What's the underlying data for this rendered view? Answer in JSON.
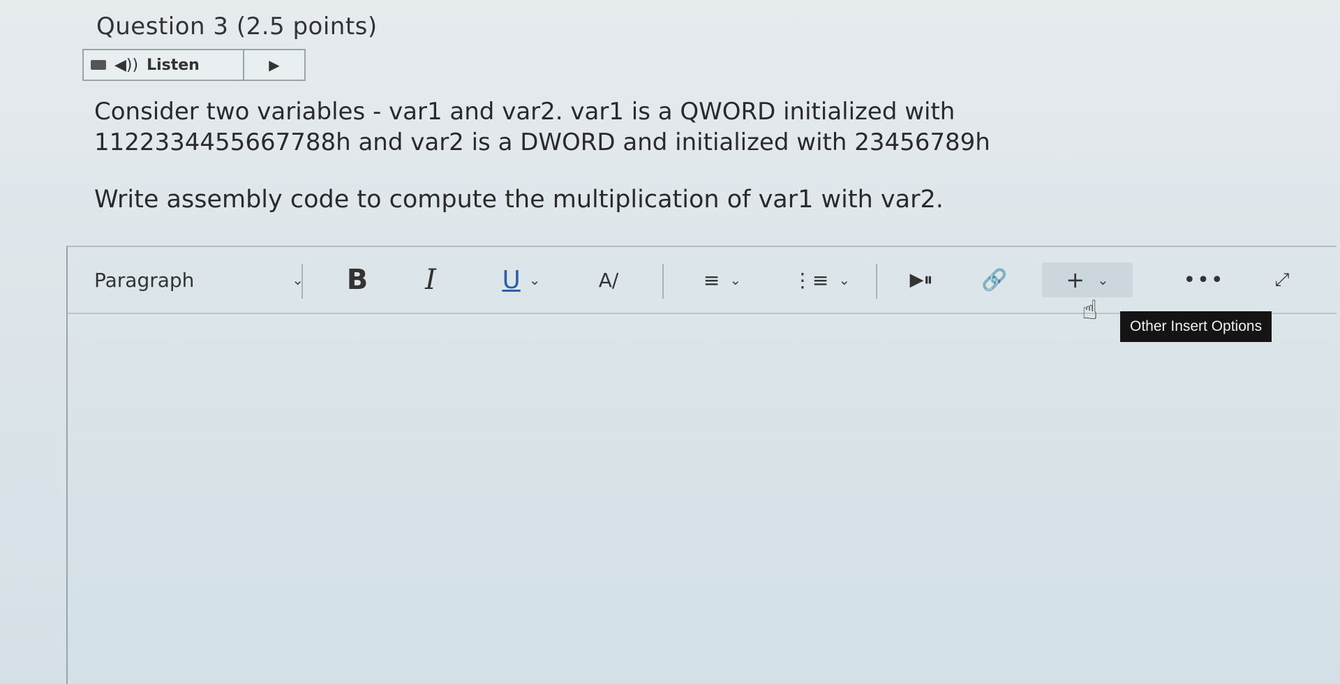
{
  "question": {
    "title": "Question 3 (2.5 points)"
  },
  "listen": {
    "menu_icon": "menu-icon",
    "speaker_icon": "speaker-icon",
    "label": "Listen",
    "play_icon": "play-icon",
    "speaker_glyph": "◀))",
    "play_glyph": "▶"
  },
  "prompt": {
    "line1": "Consider two variables - var1 and var2. var1 is a QWORD initialized with 1122334455667788h and var2 is a DWORD and initialized with 23456789h",
    "line2": "Write assembly code to compute the multiplication of var1 with var2."
  },
  "toolbar": {
    "paragraph_label": "Paragraph",
    "bold_label": "B",
    "italic_label": "I",
    "underline_label": "U",
    "format_glyph": "A/",
    "align_glyph": "≡",
    "list_glyph": "⋮≡",
    "media_glyph": "▶⏸",
    "link_glyph": "🔗",
    "insert_glyph": "+",
    "more_glyph": "•••",
    "expand_glyph": "⤢",
    "chevron_glyph": "⌄"
  },
  "tooltip": {
    "text": "Other Insert Options"
  },
  "editor": {
    "content": ""
  }
}
